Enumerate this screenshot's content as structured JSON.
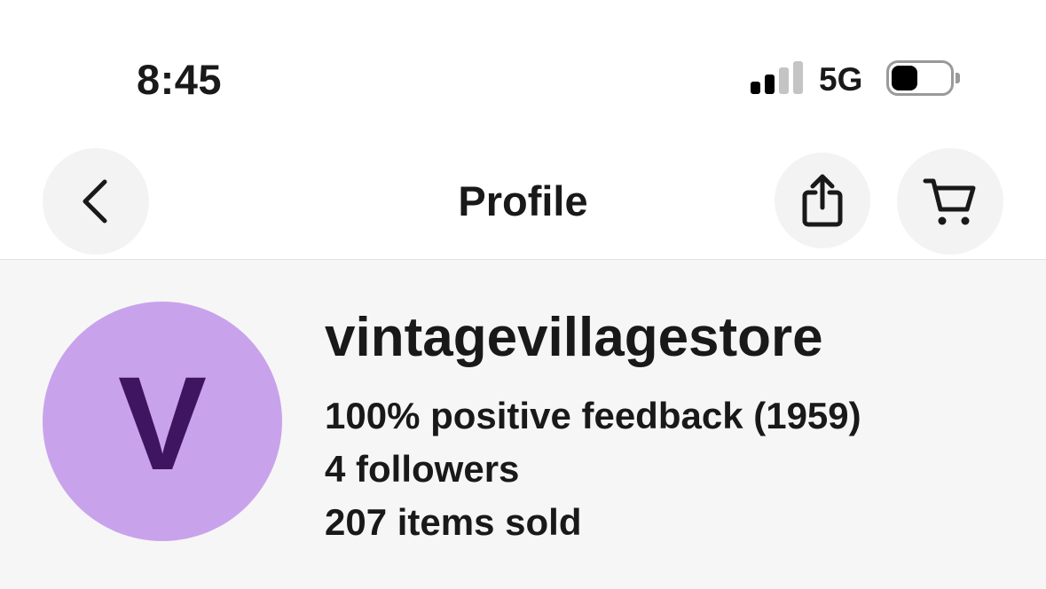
{
  "status_bar": {
    "time": "8:45",
    "network": "5G",
    "signal_bars_active": 2,
    "signal_bars_total": 4,
    "battery_level": 0.45,
    "battery_color": "#000000"
  },
  "header": {
    "title": "Profile",
    "back_icon": "chevron-left-icon",
    "share_icon": "share-icon",
    "cart_icon": "cart-icon"
  },
  "profile": {
    "avatar_letter": "V",
    "avatar_bg": "#c9a2ec",
    "avatar_fg": "#3f1562",
    "username": "vintagevillagestore",
    "feedback": "100% positive feedback (1959)",
    "followers": "4 followers",
    "items_sold": "207 items sold"
  }
}
